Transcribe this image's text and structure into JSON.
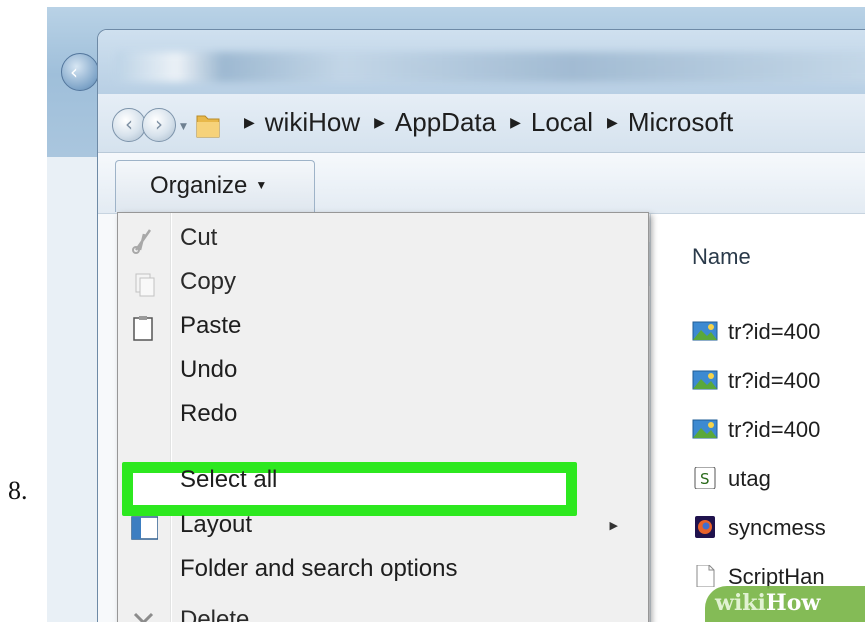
{
  "step": {
    "number": "8."
  },
  "address": {
    "crumbs": [
      "wikiHow",
      "AppData",
      "Local",
      "Microsoft"
    ]
  },
  "toolbar": {
    "organize_label": "Organize"
  },
  "filelist": {
    "column_name": "Name",
    "files": [
      {
        "name": "tr?id=400",
        "icon": "image-file-icon"
      },
      {
        "name": "tr?id=400",
        "icon": "image-file-icon"
      },
      {
        "name": "tr?id=400",
        "icon": "image-file-icon"
      },
      {
        "name": "utag",
        "icon": "script-file-icon"
      },
      {
        "name": "syncmess",
        "icon": "firefox-file-icon"
      },
      {
        "name": "ScriptHan",
        "icon": "blank-file-icon"
      }
    ]
  },
  "menu": {
    "items": [
      {
        "label": "Cut",
        "icon": "scissors-icon",
        "enabled": false
      },
      {
        "label": "Copy",
        "icon": "copy-icon",
        "enabled": false
      },
      {
        "label": "Paste",
        "icon": "clipboard-icon",
        "enabled": true
      },
      {
        "label": "Undo",
        "icon": "",
        "enabled": true
      },
      {
        "label": "Redo",
        "icon": "",
        "enabled": true
      },
      {
        "label": "Select all",
        "icon": "",
        "enabled": true,
        "highlighted": true
      },
      {
        "label": "Layout",
        "icon": "layout-icon",
        "enabled": true,
        "submenu": true
      },
      {
        "label": "Folder and search options",
        "icon": "",
        "enabled": true
      },
      {
        "label": "Delete",
        "icon": "delete-x-icon",
        "enabled": false
      }
    ]
  },
  "watermark": {
    "brand_a": "wiki",
    "brand_b": "How"
  },
  "colors": {
    "highlight_border": "#2de81f",
    "menu_bg": "#f0f0f0",
    "window_frame": "#b8cfe4"
  }
}
